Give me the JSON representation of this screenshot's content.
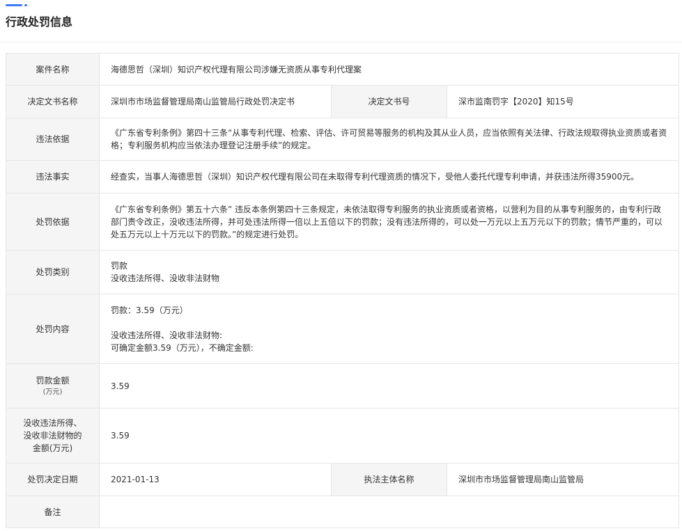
{
  "section_title": "行政处罚信息",
  "rows": {
    "case_name": {
      "label": "案件名称",
      "value": "海德思哲（深圳）知识产权代理有限公司涉嫌无资质从事专利代理案"
    },
    "decision_doc": {
      "label": "决定文书名称",
      "value": "深圳市市场监督管理局南山监管局行政处罚决定书",
      "label2": "决定文书号",
      "value2": "深市监南罚字【2020】知15号"
    },
    "violation_basis": {
      "label": "违法依据",
      "value": "《广东省专利条例》第四十三条“从事专利代理、检索、评估、许可贸易等服务的机构及其从业人员，应当依照有关法律、行政法规取得执业资质或者资格；专利服务机构应当依法办理登记注册手续”的规定。"
    },
    "violation_facts": {
      "label": "违法事实",
      "value": "经查实，当事人海德思哲（深圳）知识产权代理有限公司在未取得专利代理资质的情况下，受他人委托代理专利申请，并获违法所得35900元。"
    },
    "penalty_basis": {
      "label": "处罚依据",
      "value": "《广东省专利条例》第五十六条” 违反本条例第四十三条规定，未依法取得专利服务的执业资质或者资格，以营利为目的从事专利服务的，由专利行政部门责令改正，没收违法所得，并可处违法所得一倍以上五倍以下的罚款；没有违法所得的，可以处一万元以上五万元以下的罚款；情节严重的，可以处五万元以上十万元以下的罚款。”的规定进行处罚。"
    },
    "penalty_type": {
      "label": "处罚类别",
      "line1": "罚款",
      "line2": "没收违法所得、没收非法财物"
    },
    "penalty_content": {
      "label": "处罚内容",
      "line1": "罚款：3.59（万元）",
      "line2": "没收违法所得、没收非法财物:",
      "line3": "可确定金额3.59（万元），不确定金额:"
    },
    "fine_amount": {
      "label": "罚款金额",
      "label_sub": "(万元)",
      "value": "3.59"
    },
    "confiscation_amount": {
      "label_l1": "没收违法所得、",
      "label_l2": "没收非法财物的",
      "label_l3": "金额(万元)",
      "value": "3.59"
    },
    "decision_date": {
      "label": "处罚决定日期",
      "value": "2021-01-13",
      "label2": "执法主体名称",
      "value2": "深圳市市场监督管理局南山监管局"
    },
    "remarks": {
      "label": "备注",
      "value": ""
    }
  }
}
